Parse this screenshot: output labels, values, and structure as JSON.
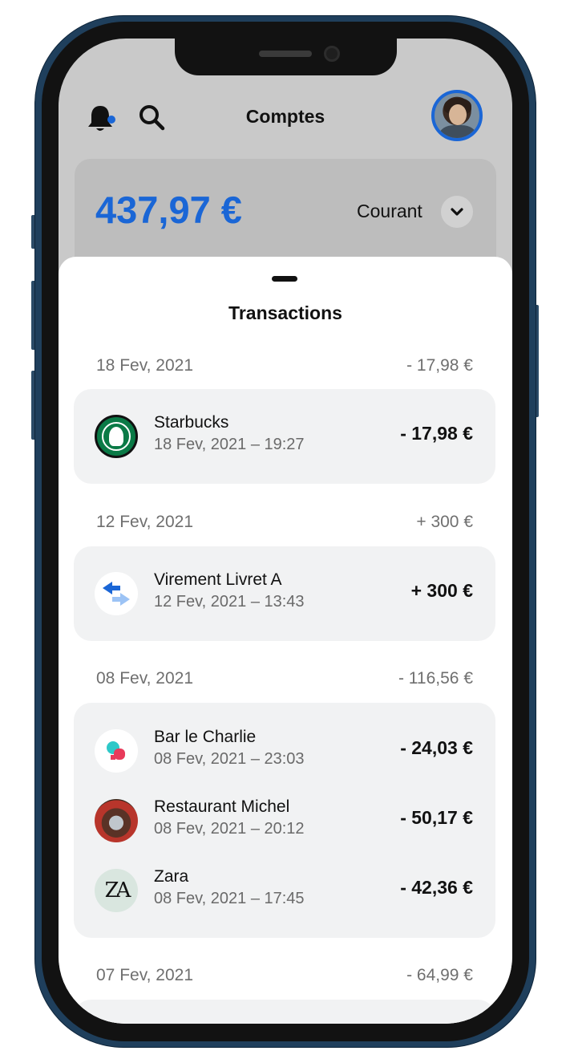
{
  "header": {
    "title": "Comptes",
    "bell_icon": "bell-icon",
    "search_icon": "search-icon"
  },
  "account": {
    "balance": "437,97 €",
    "type": "Courant"
  },
  "sheet": {
    "title": "Transactions"
  },
  "groups": [
    {
      "date": "18 Fev, 2021",
      "total": "- 17,98 €",
      "transactions": [
        {
          "name": "Starbucks",
          "time": "18 Fev, 2021 – 19:27",
          "amount": "- 17,98 €",
          "logo": "starbucks-logo"
        }
      ]
    },
    {
      "date": "12 Fev, 2021",
      "total": "+ 300 €",
      "transactions": [
        {
          "name": "Virement Livret A",
          "time": "12 Fev, 2021 – 13:43",
          "amount": "+ 300 €",
          "logo": "transfer-icon"
        }
      ]
    },
    {
      "date": "08 Fev, 2021",
      "total": "- 116,56 €",
      "transactions": [
        {
          "name": "Bar le Charlie",
          "time": "08 Fev, 2021 – 23:03",
          "amount": "- 24,03 €",
          "logo": "bar-logo"
        },
        {
          "name": "Restaurant Michel",
          "time": "08 Fev, 2021 – 20:12",
          "amount": "- 50,17 €",
          "logo": "restaurant-photo"
        },
        {
          "name": "Zara",
          "time": "08 Fev, 2021 – 17:45",
          "amount": "- 42,36 €",
          "logo": "zara-logo",
          "logo_text": "ZA"
        }
      ]
    },
    {
      "date": "07 Fev, 2021",
      "total": "- 64,99 €",
      "transactions": []
    }
  ],
  "colors": {
    "accent": "#1a66d6",
    "background_dim": "#c9c9c9",
    "card": "#f1f2f3"
  }
}
